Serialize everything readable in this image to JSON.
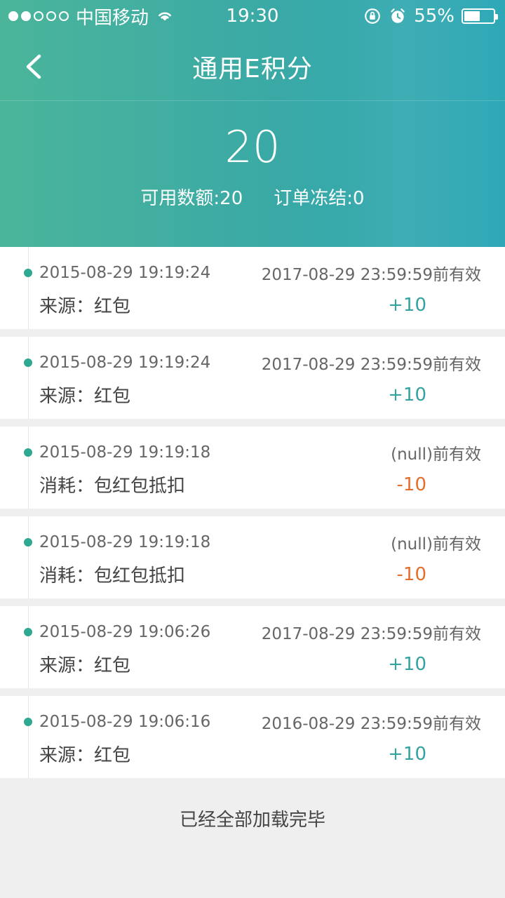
{
  "status_bar": {
    "carrier": "中国移动",
    "time": "19:30",
    "battery": "55%",
    "battery_level": 0.55
  },
  "nav": {
    "title": "通用E积分",
    "back_icon": "chevron-left-icon"
  },
  "summary": {
    "balance": "20",
    "available": "可用数额:20",
    "frozen": "订单冻结:0"
  },
  "records": [
    {
      "datetime": "2015-08-29 19:19:24",
      "expiry": "2017-08-29 23:59:59前有效",
      "desc": "来源：红包",
      "amount": "+10",
      "amount_type": "positive"
    },
    {
      "datetime": "2015-08-29 19:19:24",
      "expiry": "2017-08-29 23:59:59前有效",
      "desc": "来源：红包",
      "amount": "+10",
      "amount_type": "positive"
    },
    {
      "datetime": "2015-08-29 19:19:18",
      "expiry": "(null)前有效",
      "desc": "消耗：包红包抵扣",
      "amount": "-10",
      "amount_type": "negative"
    },
    {
      "datetime": "2015-08-29 19:19:18",
      "expiry": "(null)前有效",
      "desc": "消耗：包红包抵扣",
      "amount": "-10",
      "amount_type": "negative"
    },
    {
      "datetime": "2015-08-29 19:06:26",
      "expiry": "2017-08-29 23:59:59前有效",
      "desc": "来源：红包",
      "amount": "+10",
      "amount_type": "positive"
    },
    {
      "datetime": "2015-08-29 19:06:16",
      "expiry": "2016-08-29 23:59:59前有效",
      "desc": "来源：红包",
      "amount": "+10",
      "amount_type": "positive"
    }
  ],
  "footer": {
    "text": "已经全部加载完毕"
  },
  "colors": {
    "accent": "#35a2a1",
    "negative": "#e46f2d",
    "timeline_dot": "#2fa892"
  }
}
